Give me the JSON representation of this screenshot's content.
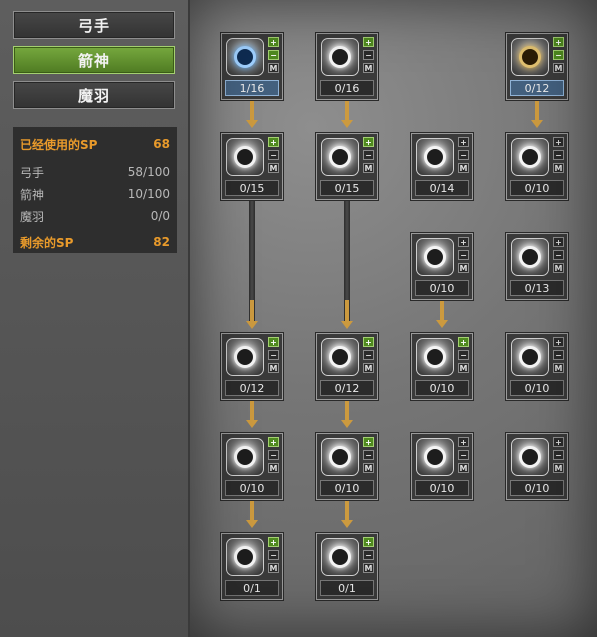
{
  "tabs": [
    {
      "label": "弓手",
      "active": false
    },
    {
      "label": "箭神",
      "active": true
    },
    {
      "label": "魔羽",
      "active": false
    }
  ],
  "sp": {
    "used_label": "已经使用的SP",
    "used_value": "68",
    "rows": [
      {
        "label": "弓手",
        "value": "58/100"
      },
      {
        "label": "箭神",
        "value": "10/100"
      },
      {
        "label": "魔羽",
        "value": "0/0"
      }
    ],
    "remain_label": "剩余的SP",
    "remain_value": "82"
  },
  "buttons": {
    "plus": "+",
    "minus": "−",
    "max": "M"
  },
  "skills": [
    {
      "name": "skill-1",
      "level": "1/16",
      "learned": true,
      "style": "blue"
    },
    {
      "name": "skill-2",
      "level": "0/16",
      "learned": false,
      "style": "dark"
    },
    {
      "name": "skill-3",
      "level": "0/12",
      "learned": true,
      "style": "gold"
    },
    {
      "name": "skill-4",
      "level": "0/15",
      "learned": false,
      "style": "dark"
    },
    {
      "name": "skill-5",
      "level": "0/15",
      "learned": false,
      "style": "dark"
    },
    {
      "name": "skill-6",
      "level": "0/14",
      "learned": false,
      "style": "dark"
    },
    {
      "name": "skill-7",
      "level": "0/10",
      "learned": false,
      "style": "dark"
    },
    {
      "name": "skill-8",
      "level": "0/10",
      "learned": false,
      "style": "dark"
    },
    {
      "name": "skill-9",
      "level": "0/13",
      "learned": false,
      "style": "dark"
    },
    {
      "name": "skill-10",
      "level": "0/12",
      "learned": false,
      "style": "dark"
    },
    {
      "name": "skill-11",
      "level": "0/12",
      "learned": false,
      "style": "dark"
    },
    {
      "name": "skill-12",
      "level": "0/10",
      "learned": false,
      "style": "dark"
    },
    {
      "name": "skill-13",
      "level": "0/10",
      "learned": false,
      "style": "dark"
    },
    {
      "name": "skill-14",
      "level": "0/10",
      "learned": false,
      "style": "dark"
    },
    {
      "name": "skill-15",
      "level": "0/10",
      "learned": false,
      "style": "dark"
    },
    {
      "name": "skill-16",
      "level": "0/10",
      "learned": false,
      "style": "dark"
    },
    {
      "name": "skill-17",
      "level": "0/10",
      "learned": false,
      "style": "dark"
    },
    {
      "name": "skill-18",
      "level": "0/1",
      "learned": false,
      "style": "dark"
    },
    {
      "name": "skill-19",
      "level": "0/1",
      "learned": false,
      "style": "dark"
    }
  ]
}
